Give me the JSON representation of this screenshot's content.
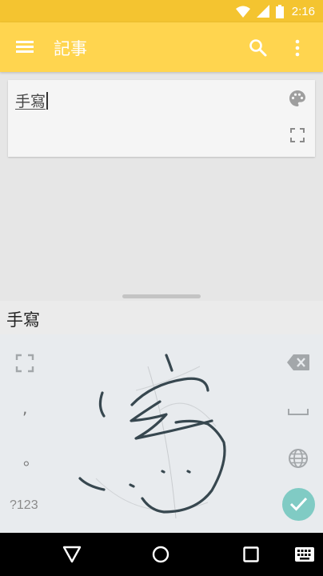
{
  "status_bar": {
    "time": "2:16",
    "icons": [
      "wifi-icon",
      "cell-signal-icon",
      "battery-icon"
    ]
  },
  "app_bar": {
    "title": "記事",
    "icons": [
      "menu-icon",
      "search-icon",
      "more-vert-icon"
    ]
  },
  "note": {
    "text": "手寫",
    "icons": [
      "palette-icon",
      "fullscreen-icon"
    ]
  },
  "candidate_bar": {
    "suggestion": "手寫"
  },
  "keyboard": {
    "comma_key": ",",
    "period_key": "。",
    "symbols_key": "?123",
    "icons": [
      "expand-icon",
      "backspace-icon",
      "space-icon",
      "globe-icon",
      "check-icon"
    ],
    "ink_stroke_color": "#37474f",
    "confirm_color": "#80cbc4"
  },
  "nav_bar": {
    "icons": [
      "back-icon",
      "home-icon",
      "recents-icon",
      "keyboard-switch-icon"
    ]
  },
  "colors": {
    "status_bar": "#f4c430",
    "app_bar": "#ffd54f",
    "background": "#e6e6e6",
    "keyboard": "#e8ebee"
  }
}
